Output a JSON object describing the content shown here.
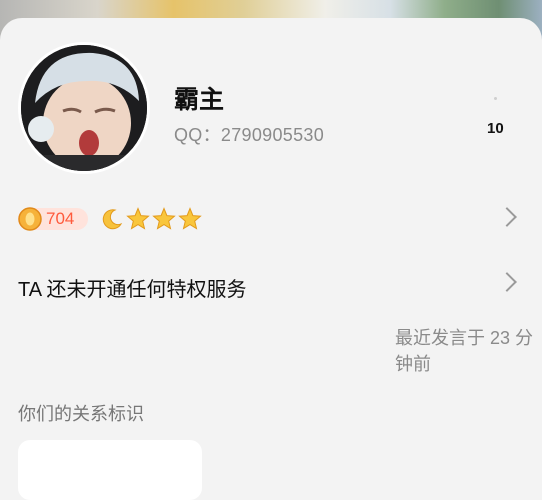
{
  "profile": {
    "name": "霸主",
    "qq_label": "QQ：2790905530",
    "count": "10"
  },
  "level": {
    "coin_count": "704",
    "icons": [
      "coin-icon",
      "moon-icon",
      "star-icon",
      "star-icon",
      "star-icon"
    ],
    "accent_color": "#ff5a3c"
  },
  "privilege": {
    "text": "TA 还未开通任何特权服务"
  },
  "last_speak": {
    "text": "最近发言于 23 分钟前"
  },
  "relation": {
    "title": "你们的关系标识"
  }
}
